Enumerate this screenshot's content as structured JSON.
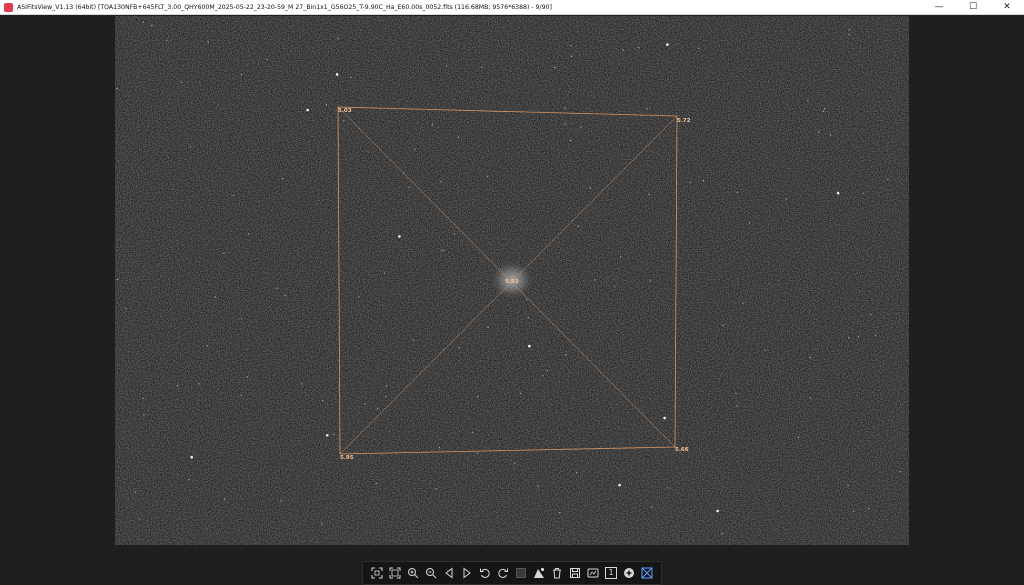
{
  "window": {
    "title": "ASIFitsView_V1.13 (64bit) [TOA130NFB+645FLT_3.00_QHY600M_2025-05-22_23-20-59_M 27_Bin1x1_G56O25_T-9.90C_Ha_E60.00s_0052.fits (116.68MB; 9576*6388) - 9/90]",
    "minimize_glyph": "—",
    "maximize_glyph": "☐",
    "close_glyph": "✕"
  },
  "overlay": {
    "corner_top_left": "5.03",
    "corner_top_right": "5.72",
    "corner_bottom_left": "5.95",
    "corner_bottom_right": "5.66",
    "center": "5.53",
    "line_color": "#d99560"
  },
  "toolbar": {
    "icons": [
      "fit-to-window-icon",
      "actual-size-icon",
      "zoom-in-icon",
      "zoom-out-icon",
      "previous-image-icon",
      "next-image-icon",
      "rotate-left-icon",
      "rotate-right-icon",
      "stretch-icon",
      "histogram-icon",
      "delete-icon",
      "save-icon",
      "export-icon",
      "one-to-one-icon",
      "star-detect-icon",
      "hfr-map-icon"
    ],
    "one_to_one_label": "1"
  },
  "colors": {
    "background": "#1f1f1f",
    "sky": "#2a2a2a",
    "accent": "#5aa0ff"
  }
}
